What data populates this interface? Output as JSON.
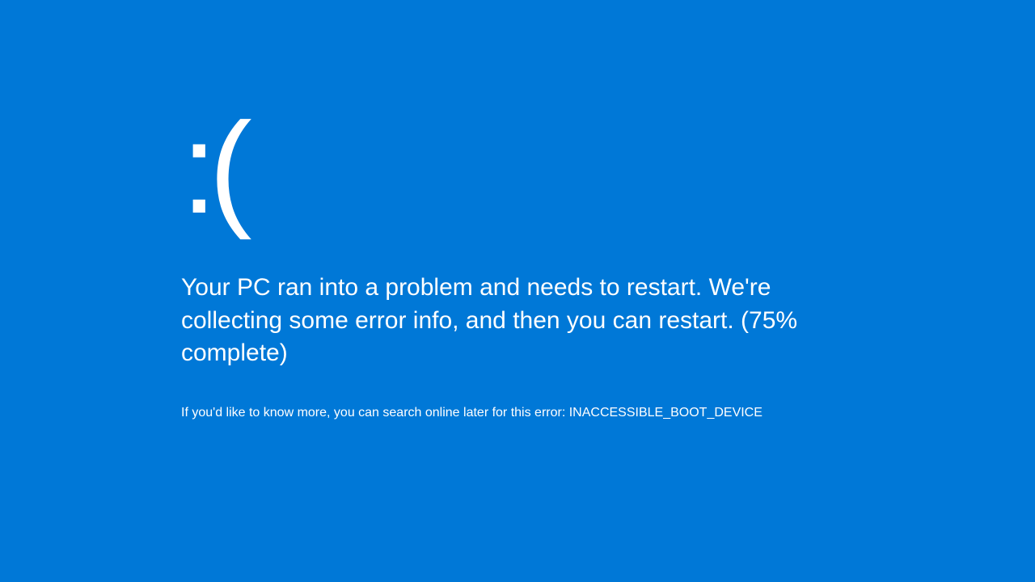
{
  "bsod": {
    "sad_face": ":(",
    "message": "Your PC ran into a problem and needs to restart. We're collecting some error info, and then you can restart. (75% complete)",
    "progress_percent": 75,
    "info_prefix": "If you'd like to know more, you can search online later for this error: ",
    "error_code": "INACCESSIBLE_BOOT_DEVICE",
    "colors": {
      "background": "#0078d7",
      "text": "#ffffff"
    }
  }
}
